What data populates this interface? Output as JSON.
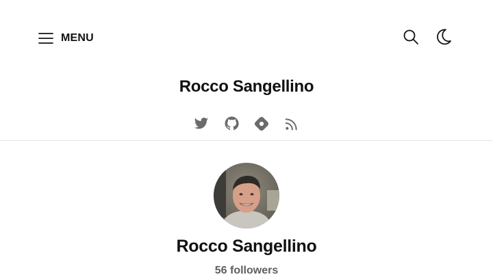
{
  "header": {
    "menu_label": "MENU",
    "site_title": "Rocco Sangellino",
    "icons": {
      "menu": "menu-icon",
      "search": "search-icon",
      "theme": "moon-icon"
    }
  },
  "social_links": [
    {
      "name": "twitter",
      "icon": "twitter-icon"
    },
    {
      "name": "github",
      "icon": "github-icon"
    },
    {
      "name": "hashnode",
      "icon": "hashnode-icon"
    },
    {
      "name": "rss",
      "icon": "rss-icon"
    }
  ],
  "profile": {
    "name": "Rocco Sangellino",
    "followers": "56 followers"
  },
  "colors": {
    "text": "#111111",
    "muted": "#5f5f5f",
    "icon": "#6b6b6b",
    "divider": "#e6e6e6",
    "background": "#ffffff"
  }
}
